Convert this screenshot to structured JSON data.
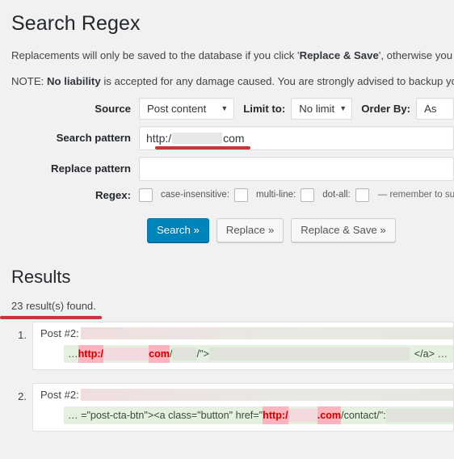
{
  "page": {
    "title": "Search Regex",
    "intro_line_1_prefix": "Replacements will only be saved to the database if you click '",
    "intro_line_1_bold": "Replace & Save",
    "intro_line_1_suffix": "', otherwise you wil",
    "intro_line_2_prefix": "NOTE: ",
    "intro_line_2_bold": "No liability",
    "intro_line_2_suffix": " is accepted for any damage caused. You are strongly advised to backup your"
  },
  "form": {
    "source": {
      "label": "Source",
      "value": "Post content",
      "caret": "chevron-down-icon"
    },
    "limit": {
      "label": "Limit to:",
      "value": "No limit",
      "caret": "chevron-down-icon"
    },
    "order_by": {
      "label": "Order By:",
      "value": "As"
    },
    "search_pattern": {
      "label": "Search pattern",
      "value_prefix": "http:/",
      "value_redacted": true,
      "value_suffix": "com",
      "annotated": true
    },
    "replace_pattern": {
      "label": "Replace pattern",
      "value": "",
      "placeholder": ""
    },
    "regex_options": {
      "label": "Regex:",
      "checkboxes": [
        {
          "name": "regex",
          "label": "",
          "checked": false
        },
        {
          "name": "case-insensitive",
          "label": "case-insensitive:",
          "checked": false
        },
        {
          "name": "multi-line",
          "label": "multi-line:",
          "checked": false
        },
        {
          "name": "dot-all",
          "label": "dot-all:",
          "checked": false
        }
      ],
      "note": "— remember to surround you"
    }
  },
  "buttons": {
    "search": "Search »",
    "replace": "Replace »",
    "replace_and_save": "Replace & Save »"
  },
  "results": {
    "heading": "Results",
    "count_text": "23 result(s) found.",
    "count_annotated": true,
    "items": [
      {
        "number": "1.",
        "post_label": "Post #2:",
        "title_redacted": true,
        "code_lead": "… ",
        "match_prefix": "http:/",
        "match_suffix": "com",
        "code_after_match": "/",
        "code_tail_1": "/\">",
        "code_tail_2": "</a> …"
      },
      {
        "number": "2.",
        "post_label": "Post #2:",
        "title_redacted": true,
        "code_lead": "… =\"post-cta-btn\"><a class=\"button\" href=\"",
        "match_prefix": "http:/",
        "match_suffix": ".com",
        "code_after_match": "/contact/\":",
        "code_tail_1": "",
        "code_tail_2": ""
      }
    ]
  },
  "colors": {
    "page_background": "#f1f1f1",
    "primary_button": "#0085ba",
    "primary_button_border": "#0073aa",
    "annotation_red": "#c5353a",
    "match_highlight_background": "#ffb3bd",
    "match_highlight_text": "#cc0000",
    "code_line_background": "#e4f1e0"
  }
}
